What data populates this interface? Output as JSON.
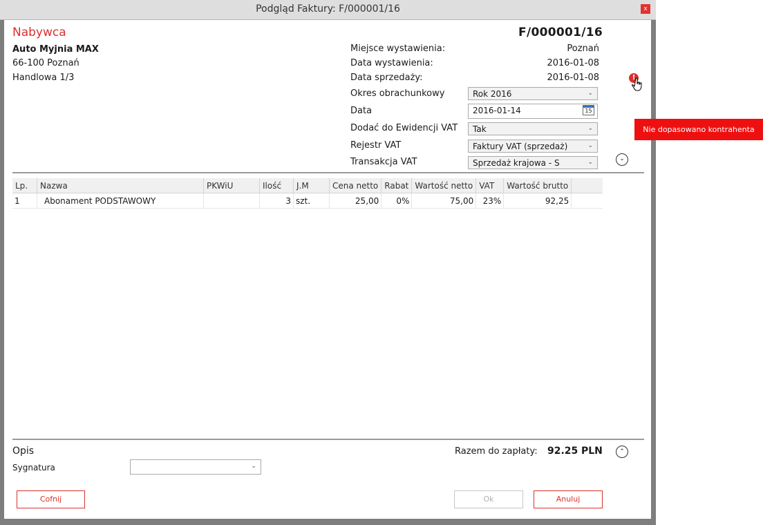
{
  "window": {
    "title": "Podgląd Faktury: F/000001/16",
    "close_label": "x"
  },
  "buyer": {
    "heading": "Nabywca",
    "name": "Auto Myjnia MAX",
    "address_line1": "66-100 Poznań",
    "address_line2": "Handlowa 1/3"
  },
  "invoice": {
    "number": "F/000001/16",
    "place_label": "Miejsce wystawienia:",
    "place": "Poznań",
    "issue_date_label": "Data wystawienia:",
    "issue_date": "2016-01-08",
    "sale_date_label": "Data sprzedaży:",
    "sale_date": "2016-01-08"
  },
  "form": {
    "period_label": "Okres obrachunkowy",
    "period_value": "Rok 2016",
    "date_label": "Data",
    "date_value": "2016-01-14",
    "calendar_day": "15",
    "vat_reg_add_label": "Dodać do Ewidencji VAT",
    "vat_reg_add_value": "Tak",
    "vat_register_label": "Rejestr VAT",
    "vat_register_value": "Faktury VAT (sprzedaż)",
    "vat_transaction_label": "Transakcja VAT",
    "vat_transaction_value": "Sprzedaż krajowa - S"
  },
  "warning": {
    "icon_text": "!",
    "tooltip": "Nie dopasowano kontrahenta"
  },
  "table": {
    "headers": [
      "Lp.",
      "Nazwa",
      "PKWiU",
      "Ilość",
      "J.M",
      "Cena netto",
      "Rabat",
      "Wartość netto",
      "VAT",
      "Wartość brutto"
    ],
    "rows": [
      [
        "1",
        "Abonament PODSTAWOWY",
        "",
        "3",
        "szt.",
        "25,00",
        "0%",
        "75,00",
        "23%",
        "92,25"
      ]
    ]
  },
  "footer": {
    "description_label": "Opis",
    "signature_label": "Sygnatura",
    "signature_value": "",
    "total_label": "Razem do zapłaty:",
    "total_value": "92.25",
    "currency": "PLN"
  },
  "buttons": {
    "back": "Cofnij",
    "ok": "Ok",
    "cancel": "Anuluj"
  }
}
